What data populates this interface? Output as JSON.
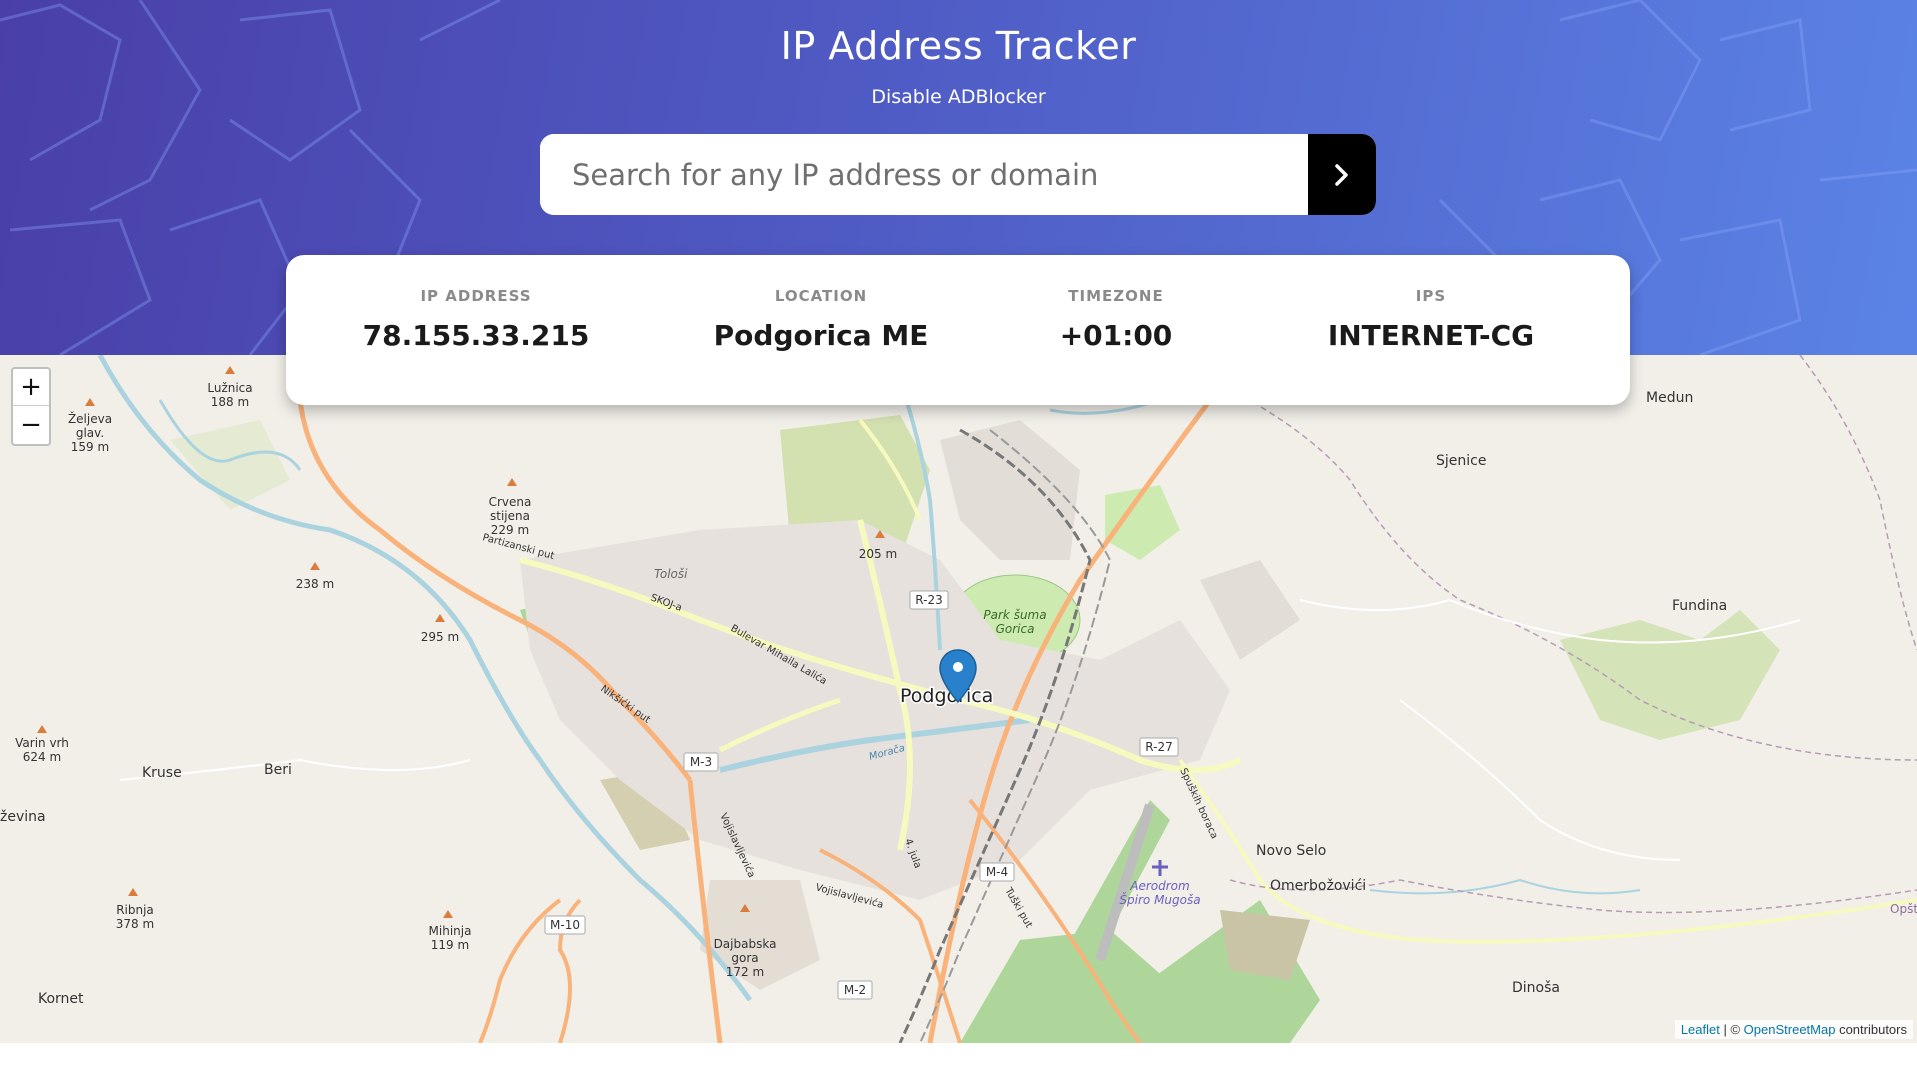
{
  "header": {
    "title": "IP Address Tracker",
    "subtitle": "Disable ADBlocker"
  },
  "search": {
    "placeholder": "Search for any IP address or domain",
    "submit_icon": "chevron-right-icon"
  },
  "info": {
    "ip_label": "IP ADDRESS",
    "ip_value": "78.155.33.215",
    "location_label": "LOCATION",
    "location_value": "Podgorica ME",
    "timezone_label": "TIMEZONE",
    "timezone_value": "+01:00",
    "isp_label": "IPS",
    "isp_value": "INTERNET-CG"
  },
  "map": {
    "zoom_in": "+",
    "zoom_out": "−",
    "marker_icon": "location-pin-icon",
    "attribution_leaflet": "Leaflet",
    "attribution_separator": " | © ",
    "attribution_osm": "OpenStreetMap",
    "attribution_suffix": " contributors",
    "labels": {
      "podgorica": "Podgorica",
      "park": "Park šuma",
      "park2": "Gorica",
      "airport": "Aerodrom",
      "airport2": "Špiro Mugoša",
      "medun": "Medun",
      "sjenice": "Sjenice",
      "fundina": "Fundina",
      "novo_selo": "Novo Selo",
      "omerbozovici": "Omerbožovići",
      "dinosa": "Dinoša",
      "kruse": "Kruse",
      "beri": "Beri",
      "kornet": "Kornet",
      "zevina": "ževina",
      "tolosi": "Tološi",
      "luznica": "Lužnica",
      "luznica_h": "188 m",
      "zeljeva": "Željeva",
      "zeljeva2": "glav.",
      "zeljeva_h": "159 m",
      "crvena": "Crvena",
      "crvena2": "stijena",
      "crvena_h": "229 m",
      "h238": "238 m",
      "h295": "295 m",
      "h205": "205 m",
      "varin": "Varin vrh",
      "varin_h": "624 m",
      "ribnja": "Ribnja",
      "ribnja_h": "378 m",
      "mihinja": "Mihinja",
      "mihinja_h": "119 m",
      "dajbabska": "Dajbabska",
      "dajbabska2": "gora",
      "dajbabska_h": "172 m",
      "r23": "R-23",
      "r27": "R-27",
      "m3": "M-3",
      "m4": "M-4",
      "m10": "M-10",
      "m2": "M-2",
      "skoj": "SKOJ-a",
      "bulevar": "Bulevar Mihaila Lalića",
      "niksicki": "Nikšićki put",
      "partizanski": "Partizanski put",
      "vojislavljevica": "Vojislavljevića",
      "moraca": "Morača",
      "tuzki": "Tuški put",
      "spuzki": "Spuških boraca",
      "jula": "4. jula",
      "opstina": "Opštin"
    }
  }
}
